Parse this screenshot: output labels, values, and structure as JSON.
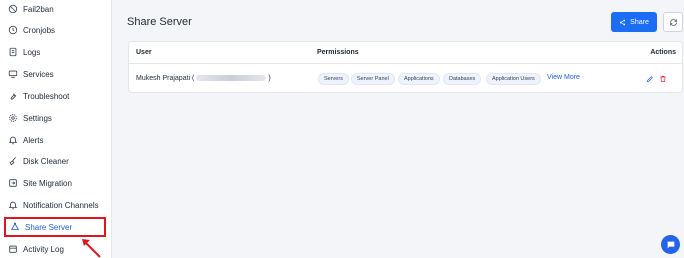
{
  "sidebar": {
    "items": [
      {
        "label": "Fail2ban",
        "icon": "ban-icon"
      },
      {
        "label": "Cronjobs",
        "icon": "clock-icon"
      },
      {
        "label": "Logs",
        "icon": "file-icon"
      },
      {
        "label": "Services",
        "icon": "server-icon"
      },
      {
        "label": "Troubleshoot",
        "icon": "tool-icon"
      },
      {
        "label": "Settings",
        "icon": "gear-icon"
      },
      {
        "label": "Alerts",
        "icon": "bell-icon"
      },
      {
        "label": "Disk Cleaner",
        "icon": "broom-icon"
      },
      {
        "label": "Site Migration",
        "icon": "migration-icon"
      },
      {
        "label": "Notification Channels",
        "icon": "bell-icon"
      },
      {
        "label": "Share Server",
        "icon": "share-icon",
        "active": true
      },
      {
        "label": "Activity Log",
        "icon": "calendar-icon"
      }
    ]
  },
  "header": {
    "title": "Share Server",
    "share_label": "Share"
  },
  "table": {
    "columns": [
      "User",
      "Permissions",
      "Actions"
    ],
    "rows": [
      {
        "user": "Mukesh Prajapati (",
        "user_suffix": ")",
        "permissions": [
          "Servers",
          "Server Panel",
          "Applications",
          "Databases",
          "Application Users"
        ],
        "view_more": "View More"
      }
    ]
  },
  "colors": {
    "accent": "#1b6ef3",
    "highlight": "#e0141c",
    "delete": "#e02424"
  }
}
